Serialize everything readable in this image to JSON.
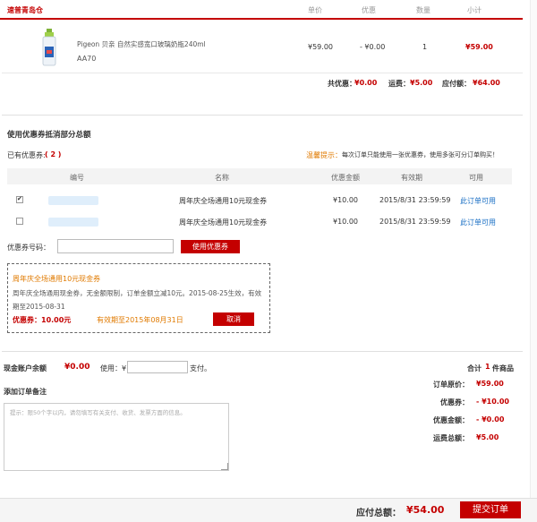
{
  "header": {
    "warehouse": "速普青岛仓",
    "col_price": "单价",
    "col_discount": "优惠",
    "col_qty": "数量",
    "col_subtotal": "小计"
  },
  "product": {
    "name": "Pigeon 贝亲 自然实感宽口玻璃奶瓶240ml",
    "code": "AA70",
    "price": "¥59.00",
    "discount": "- ¥0.00",
    "qty": "1",
    "subtotal": "¥59.00"
  },
  "summary": {
    "discount_label": "共优惠：",
    "discount_value": "¥0.00",
    "shipping_label": "运费：",
    "shipping_value": "¥5.00",
    "payable_label": "应付额：",
    "payable_value": "¥64.00"
  },
  "coupon": {
    "title": "使用优惠券抵消部分总额",
    "owned_label": "已有优惠券:",
    "owned_count": "( 2 )",
    "tip_label": "温馨提示：",
    "tip_text": "每次订单只能使用一张优惠券，使用多张可分订单购买！",
    "columns": [
      "编号",
      "名称",
      "优惠金额",
      "有效期",
      "可用"
    ],
    "rows": [
      {
        "checked": true,
        "name": "周年庆全场通用10元现金券",
        "amount": "¥10.00",
        "expiry": "2015/8/31 23:59:59",
        "usable": "此订单可用"
      },
      {
        "checked": false,
        "name": "周年庆全场通用10元现金券",
        "amount": "¥10.00",
        "expiry": "2015/8/31 23:59:59",
        "usable": "此订单可用"
      }
    ],
    "code_label": "优惠券号码：",
    "use_button": "使用优惠券",
    "selected": {
      "title": "周年庆全场通用10元现金券",
      "desc1": "周年庆全场通用现金券，无金额限制，订单金额立减10元。2015-08-25生效，有效",
      "desc2": "期至2015-08-31",
      "value_label": "优惠券：",
      "value": "10.00元",
      "valid_text": "有效期至2015年08月31日",
      "cancel_button": "取消"
    }
  },
  "account": {
    "balance_label": "现金账户余额",
    "balance_value": "¥0.00",
    "use_label": "使用：¥",
    "pay_suffix": "支付。"
  },
  "remark": {
    "title": "添加订单备注",
    "placeholder": "提示：限50个字以内，请勿填写有关支付、收货、发票方面的信息。"
  },
  "totals": {
    "count_prefix": "合计",
    "count": "1",
    "count_suffix": "件商品",
    "original_label": "订单原价：",
    "original_value": "¥59.00",
    "coupon_label": "优惠券：",
    "coupon_value": "- ¥10.00",
    "discount_label": "优惠金额：",
    "discount_value": "- ¥0.00",
    "shipping_label": "运费总额：",
    "shipping_value": "¥5.00"
  },
  "footer": {
    "total_label": "应付总额：",
    "total_value": "¥54.00",
    "submit": "提交订单"
  }
}
